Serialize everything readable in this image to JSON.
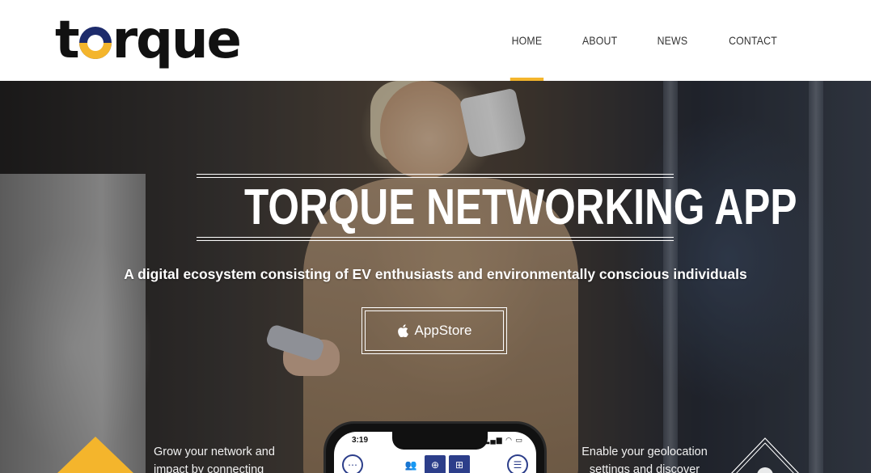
{
  "brand": {
    "logo_text_pre": "t",
    "logo_text_post": "rque",
    "accent": "#f4b52c",
    "navy": "#1d2b6b"
  },
  "nav": {
    "items": [
      {
        "label": "HOME",
        "active": true
      },
      {
        "label": "ABOUT",
        "active": false
      },
      {
        "label": "NEWS",
        "active": false
      },
      {
        "label": "CONTACT",
        "active": false
      }
    ]
  },
  "hero": {
    "title": "TORQUE NETWORKING APP",
    "subtitle": "A digital ecosystem consisting of EV enthusiasts and environmentally conscious individuals",
    "appstore_label": "AppStore",
    "appstore_icon": "apple-icon"
  },
  "features": {
    "left_text_line1": "Grow your network and",
    "left_text_line2": "impact by connecting",
    "right_text_line1": "Enable your geolocation",
    "right_text_line2": "settings and discover"
  },
  "phone_mockup": {
    "time": "3:19",
    "status": "▂▄▆ ◠ ▭",
    "menu_icon": "⋯",
    "mid_icons": [
      "👥",
      "⊕",
      "⊞"
    ],
    "right_icon": "☰"
  }
}
